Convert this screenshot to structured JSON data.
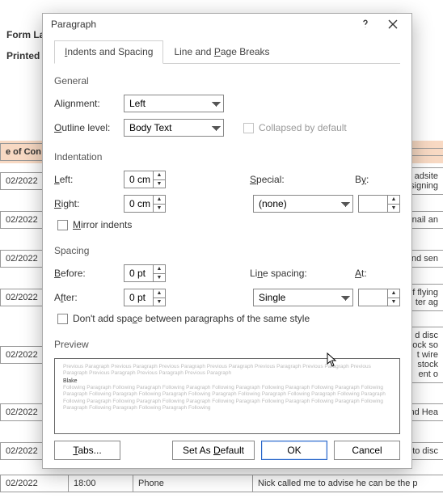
{
  "background": {
    "header1": "Form La",
    "header2": "Printed",
    "col1_header": "e of Con",
    "rows": [
      {
        "date": "02/2022",
        "right1": "adsite",
        "right2": "signing"
      },
      {
        "date": "02/2022",
        "right1": "nail an"
      },
      {
        "date": "02/2022",
        "right1": "nd sen"
      },
      {
        "date": "02/2022",
        "right1": "f flying",
        "right2": "ter ag"
      },
      {
        "date": "02/2022",
        "right1": "d disc",
        "right2": "tock so",
        "right3": "t wire",
        "right4": " stock",
        "right5": "ent o"
      },
      {
        "date": "02/2022",
        "right1": "nd Hea"
      },
      {
        "date": "02/2022",
        "right1": "to disc"
      },
      {
        "date": "02/2022",
        "time": "18:00",
        "col3": "Phone",
        "col4": "Nick called me to advise he can be the p"
      }
    ]
  },
  "dialog": {
    "title": "Paragraph",
    "tabs": {
      "t1": "Indents and Spacing",
      "t2": "Line and Page Breaks"
    },
    "sections": {
      "general": "General",
      "indentation": "Indentation",
      "spacing": "Spacing",
      "preview": "Preview"
    },
    "general": {
      "alignment_label": "Alignment:",
      "alignment_value": "Left",
      "outline_label": "Outline level:",
      "outline_value": "Body Text",
      "collapsed_label": "Collapsed by default"
    },
    "indent": {
      "left_label": "Left:",
      "left_value": "0 cm",
      "right_label": "Right:",
      "right_value": "0 cm",
      "special_label": "Special:",
      "special_value": "(none)",
      "by_label": "By:",
      "by_value": "",
      "mirror_label": "Mirror indents"
    },
    "spacing": {
      "before_label": "Before:",
      "before_value": "0 pt",
      "after_label": "After:",
      "after_value": "0 pt",
      "line_label": "Line spacing:",
      "line_value": "Single",
      "at_label": "At:",
      "at_value": "",
      "dont_add_label": "Don't add space between paragraphs of the same style"
    },
    "preview": {
      "prev_line": "Previous Paragraph Previous Paragraph Previous Paragraph Previous Paragraph Previous Paragraph Previous Paragraph Previous Paragraph Previous Paragraph Previous Paragraph Previous Paragraph",
      "sample": "Blake",
      "foll_line": "Following Paragraph Following Paragraph Following Paragraph Following Paragraph Following Paragraph Following Paragraph Following Paragraph Following Paragraph Following Paragraph Following Paragraph Following Paragraph Following Paragraph Following Paragraph Following Paragraph Following Paragraph Following Paragraph Following Paragraph Following Paragraph Following Paragraph Following Paragraph Following Paragraph Following Paragraph Following"
    },
    "buttons": {
      "tabs": "Tabs...",
      "default": "Set As Default",
      "ok": "OK",
      "cancel": "Cancel"
    }
  }
}
